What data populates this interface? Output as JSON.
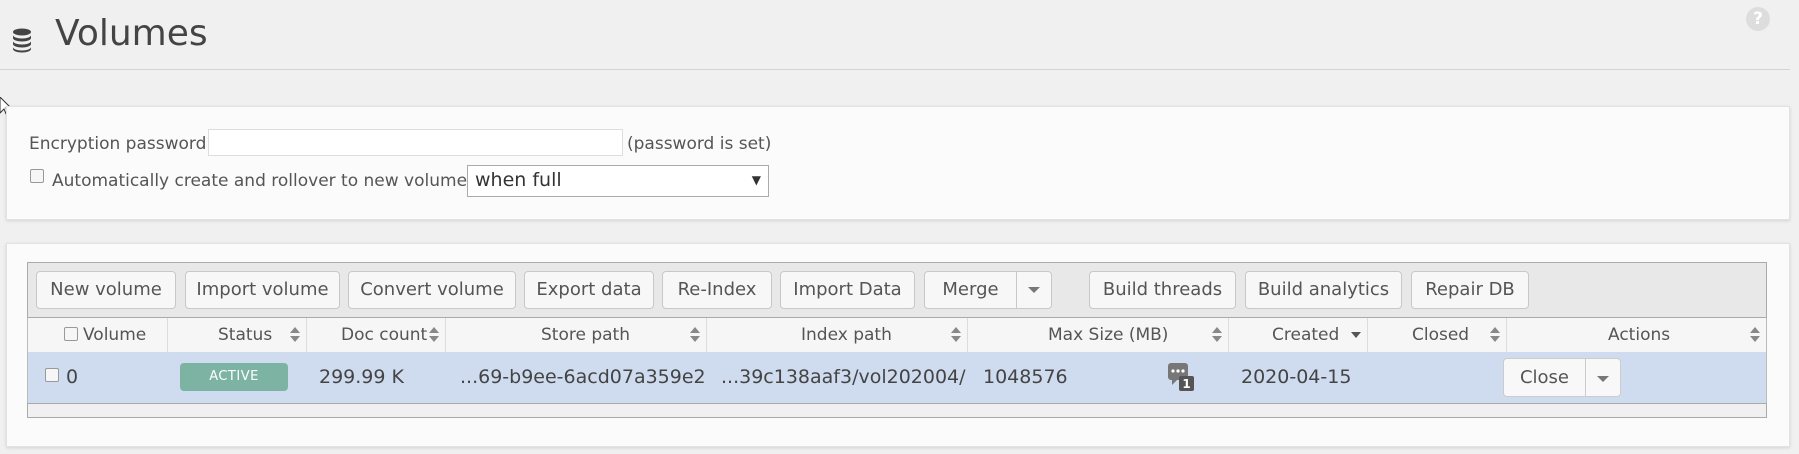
{
  "page": {
    "title": "Volumes",
    "icons": {
      "title_icon": "database-icon",
      "help_icon": "help-icon"
    },
    "help_glyph": "?"
  },
  "encryption": {
    "label": "Encryption password",
    "password_value": "",
    "status": "(password is set)",
    "auto_rollover_label": "Automatically create and rollover to new volumes",
    "auto_rollover_checked": false,
    "rollover_select_value": "when full"
  },
  "toolbar": {
    "new_volume": "New volume",
    "import_volume": "Import volume",
    "convert_volume": "Convert volume",
    "export_data": "Export data",
    "reindex": "Re-Index",
    "import_data": "Import Data",
    "merge": "Merge",
    "build_threads": "Build threads",
    "build_analytics": "Build analytics",
    "repair_db": "Repair DB"
  },
  "table": {
    "columns": {
      "volume": "Volume",
      "status": "Status",
      "doc_count": "Doc count",
      "store_path": "Store path",
      "index_path": "Index path",
      "max_size": "Max Size (MB)",
      "created": "Created",
      "closed": "Closed",
      "actions": "Actions"
    },
    "rows": [
      {
        "volume": "0",
        "status": "ACTIVE",
        "doc_count": "299.99 K",
        "store_path": "...69-b9ee-6acd07a359e2",
        "index_path": "...39c138aaf3/vol202004/",
        "max_size": "1048576",
        "thread_badge": "1",
        "created": "2020-04-15",
        "closed": "",
        "action_label": "Close"
      }
    ]
  },
  "colors": {
    "selected_row": "#cfdbef",
    "active_badge": "#7cb3a2",
    "background": "#f0f0f0"
  }
}
